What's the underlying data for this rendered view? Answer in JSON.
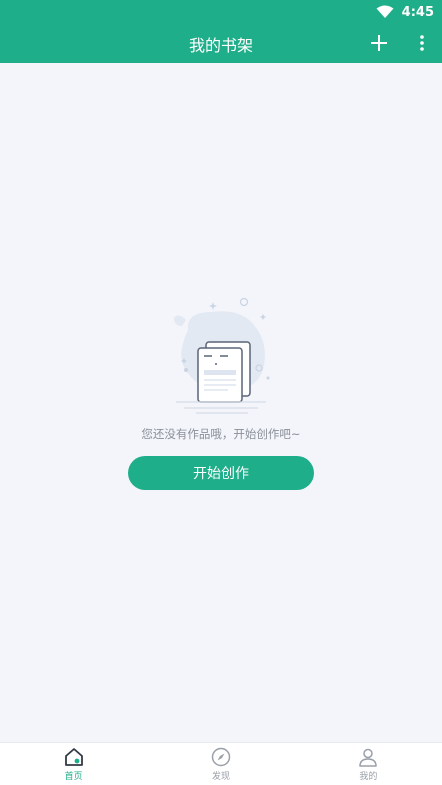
{
  "status_bar": {
    "time": "4:45"
  },
  "header": {
    "title": "我的书架",
    "add_icon": "plus-icon",
    "more_icon": "more-vertical-icon"
  },
  "empty_state": {
    "illustration": "empty-documents-illustration",
    "message": "您还没有作品哦，开始创作吧~",
    "button_label": "开始创作"
  },
  "tabs": [
    {
      "label": "首页",
      "icon": "home-icon",
      "active": true
    },
    {
      "label": "发现",
      "icon": "compass-icon",
      "active": false
    },
    {
      "label": "我的",
      "icon": "user-icon",
      "active": false
    }
  ],
  "colors": {
    "accent": "#1fae8a",
    "background": "#f3f5fa",
    "inactive": "#9aa0a8"
  }
}
